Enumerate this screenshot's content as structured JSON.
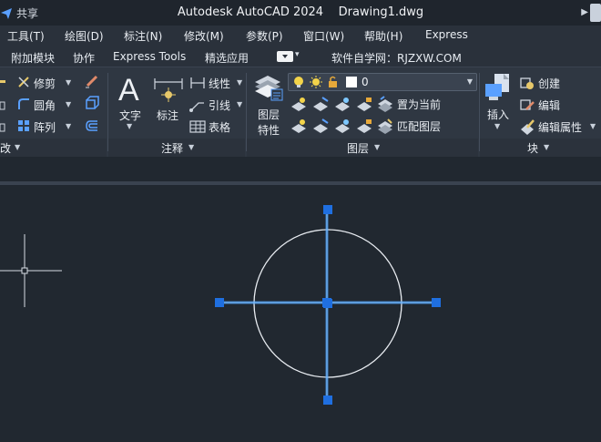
{
  "titlebar": {
    "share_label": "共享",
    "title": "Autodesk AutoCAD 2024    Drawing1.dwg"
  },
  "menubar": {
    "items": [
      "工具(T)",
      "绘图(D)",
      "标注(N)",
      "修改(M)",
      "参数(P)",
      "窗口(W)",
      "帮助(H)",
      "Express"
    ]
  },
  "tabs": {
    "items": [
      "附加模块",
      "协作",
      "Express Tools",
      "精选应用"
    ],
    "watermark": "软件自学网：RJZXW.COM"
  },
  "ribbon": {
    "modify": {
      "trim": "修剪",
      "fillet": "圆角",
      "array": "阵列",
      "panel_label": "改"
    },
    "annotation": {
      "text": "文字",
      "dimension": "标注",
      "linear": "线性",
      "leader": "引线",
      "table": "表格",
      "panel_label": "注释"
    },
    "layers": {
      "layer_props_1": "图层",
      "layer_props_2": "特性",
      "current_layer": "0",
      "set_current": "置为当前",
      "match_layer": "匹配图层",
      "panel_label": "图层"
    },
    "block": {
      "insert": "插入",
      "create": "创建",
      "edit": "编辑",
      "edit_attributes": "编辑属性",
      "panel_label": "块"
    }
  },
  "colors": {
    "selection_blue": "#1f6fe0",
    "highlight_blue": "#4aa3ff",
    "canvas_bg": "#212830",
    "ribbon_bg": "#2f3742"
  }
}
